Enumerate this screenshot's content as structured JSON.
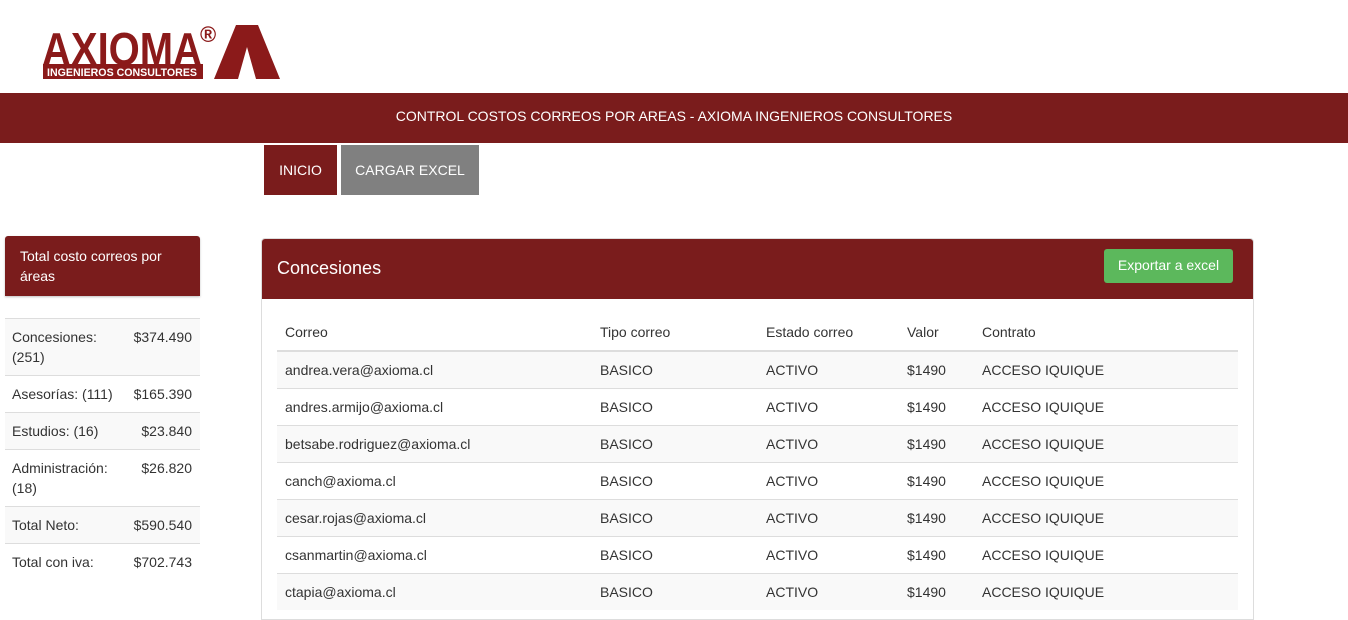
{
  "logo": {
    "name": "AXIOMA",
    "registered": "®",
    "subtitle": "INGENIEROS CONSULTORES",
    "monogram": "A"
  },
  "banner": {
    "title": "CONTROL COSTOS CORREOS POR AREAS - AXIOMA INGENIEROS CONSULTORES"
  },
  "nav": {
    "inicio": "INICIO",
    "cargar_excel": "CARGAR EXCEL"
  },
  "sidebar": {
    "heading": "Total costo correos por áreas",
    "rows": [
      {
        "label": "Concesiones: (251)",
        "value": "$374.490"
      },
      {
        "label": "Asesorías: (111)",
        "value": "$165.390"
      },
      {
        "label": "Estudios: (16)",
        "value": "$23.840"
      },
      {
        "label": "Administración: (18)",
        "value": "$26.820"
      },
      {
        "label": "Total Neto:",
        "value": "$590.540"
      },
      {
        "label": "Total con iva:",
        "value": "$702.743"
      }
    ]
  },
  "main": {
    "title": "Concesiones",
    "export_label": "Exportar a excel",
    "columns": [
      "Correo",
      "Tipo correo",
      "Estado correo",
      "Valor",
      "Contrato"
    ],
    "rows": [
      [
        "andrea.vera@axioma.cl",
        "BASICO",
        "ACTIVO",
        "$1490",
        "ACCESO IQUIQUE"
      ],
      [
        "andres.armijo@axioma.cl",
        "BASICO",
        "ACTIVO",
        "$1490",
        "ACCESO IQUIQUE"
      ],
      [
        "betsabe.rodriguez@axioma.cl",
        "BASICO",
        "ACTIVO",
        "$1490",
        "ACCESO IQUIQUE"
      ],
      [
        "canch@axioma.cl",
        "BASICO",
        "ACTIVO",
        "$1490",
        "ACCESO IQUIQUE"
      ],
      [
        "cesar.rojas@axioma.cl",
        "BASICO",
        "ACTIVO",
        "$1490",
        "ACCESO IQUIQUE"
      ],
      [
        "csanmartin@axioma.cl",
        "BASICO",
        "ACTIVO",
        "$1490",
        "ACCESO IQUIQUE"
      ],
      [
        "ctapia@axioma.cl",
        "BASICO",
        "ACTIVO",
        "$1490",
        "ACCESO IQUIQUE"
      ]
    ]
  },
  "colors": {
    "brand": "#7a1c1c",
    "nav_inactive": "#808080",
    "export": "#5cb85c"
  }
}
